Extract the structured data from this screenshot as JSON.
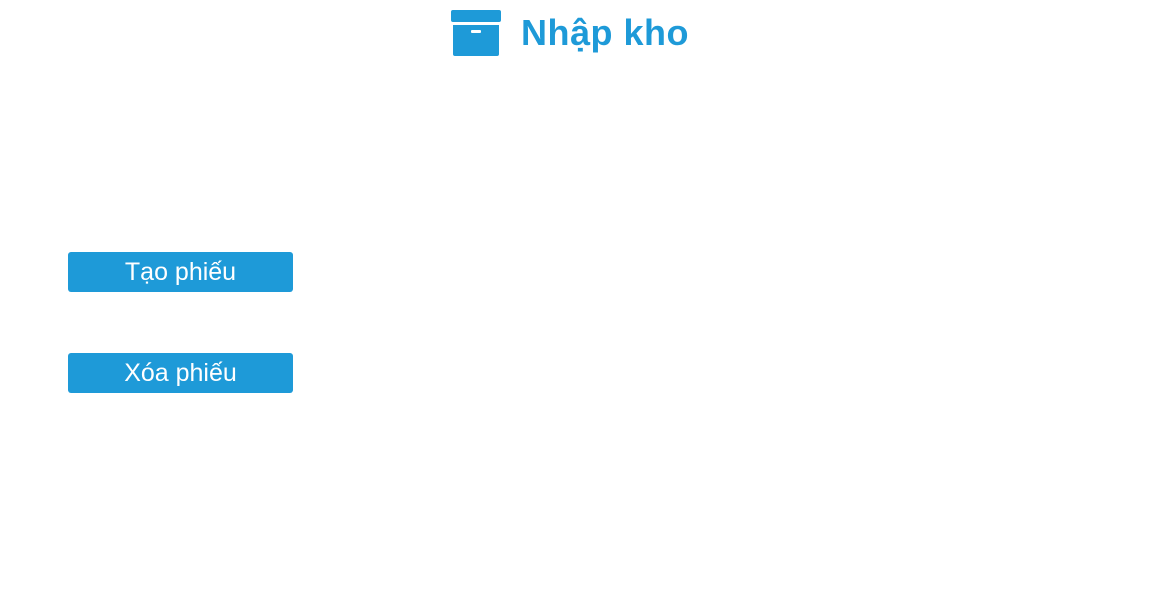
{
  "header": {
    "icon": "archive-box-icon",
    "title": "Nhập kho"
  },
  "actions": {
    "create_label": "Tạo phiếu",
    "delete_label": "Xóa phiếu"
  },
  "colors": {
    "accent": "#1e9ad8",
    "background": "#ffffff",
    "button_text": "#ffffff"
  }
}
